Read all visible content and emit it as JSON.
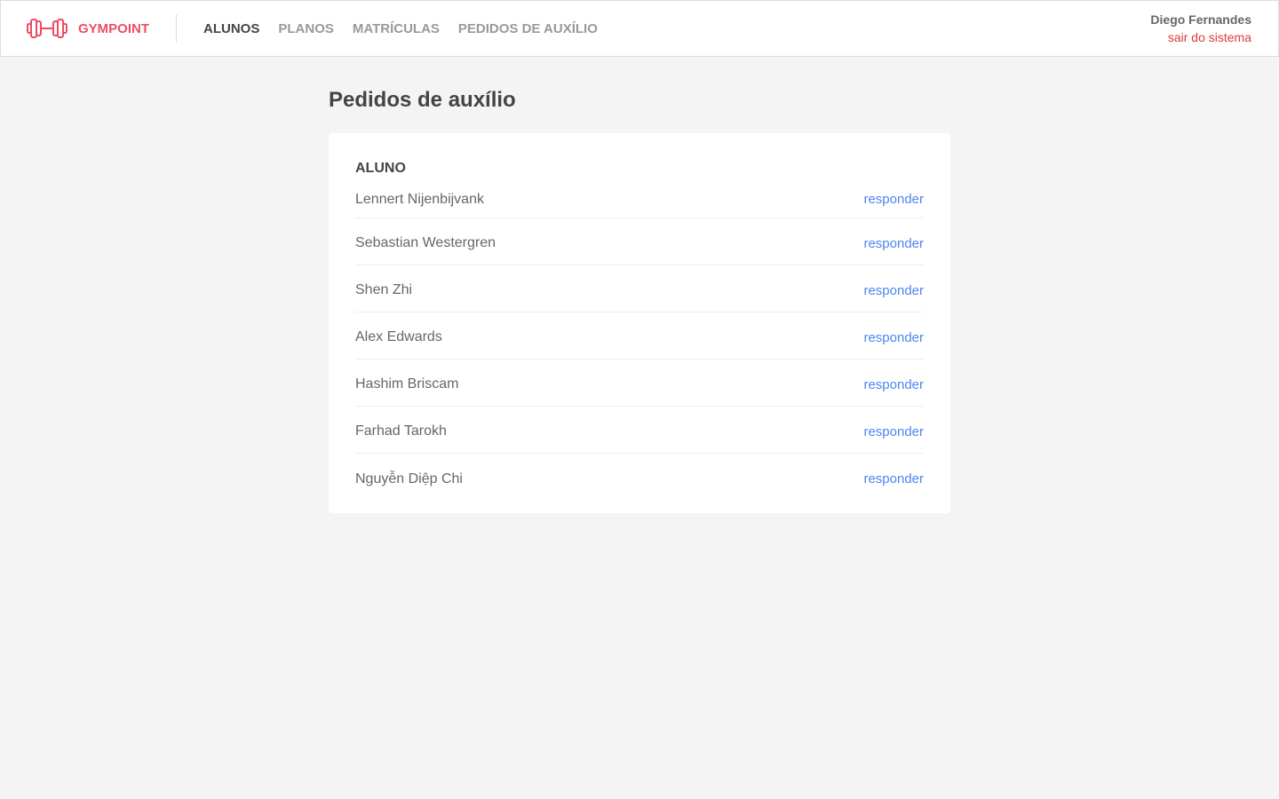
{
  "header": {
    "brand": "GYMPOINT",
    "nav": [
      {
        "label": "ALUNOS",
        "active": true
      },
      {
        "label": "PLANOS",
        "active": false
      },
      {
        "label": "MATRÍCULAS",
        "active": false
      },
      {
        "label": "PEDIDOS DE AUXÍLIO",
        "active": false
      }
    ],
    "user_name": "Diego Fernandes",
    "logout_label": "sair do sistema"
  },
  "main": {
    "title": "Pedidos de auxílio",
    "table": {
      "column_header": "ALUNO",
      "rows": [
        {
          "student": "Lennert Nijenbijvank",
          "action": "responder"
        },
        {
          "student": "Sebastian Westergren",
          "action": "responder"
        },
        {
          "student": "Shen Zhi",
          "action": "responder"
        },
        {
          "student": "Alex Edwards",
          "action": "responder"
        },
        {
          "student": "Hashim Briscam",
          "action": "responder"
        },
        {
          "student": "Farhad Tarokh",
          "action": "responder"
        },
        {
          "student": "Nguyễn Diệp Chi",
          "action": "responder"
        }
      ]
    }
  },
  "colors": {
    "brand": "#ee4d64",
    "link": "#4d85ee",
    "logout": "#de3b3b",
    "background": "#f4f4f4"
  },
  "icons": {
    "brand_logo": "dumbbell-icon"
  }
}
